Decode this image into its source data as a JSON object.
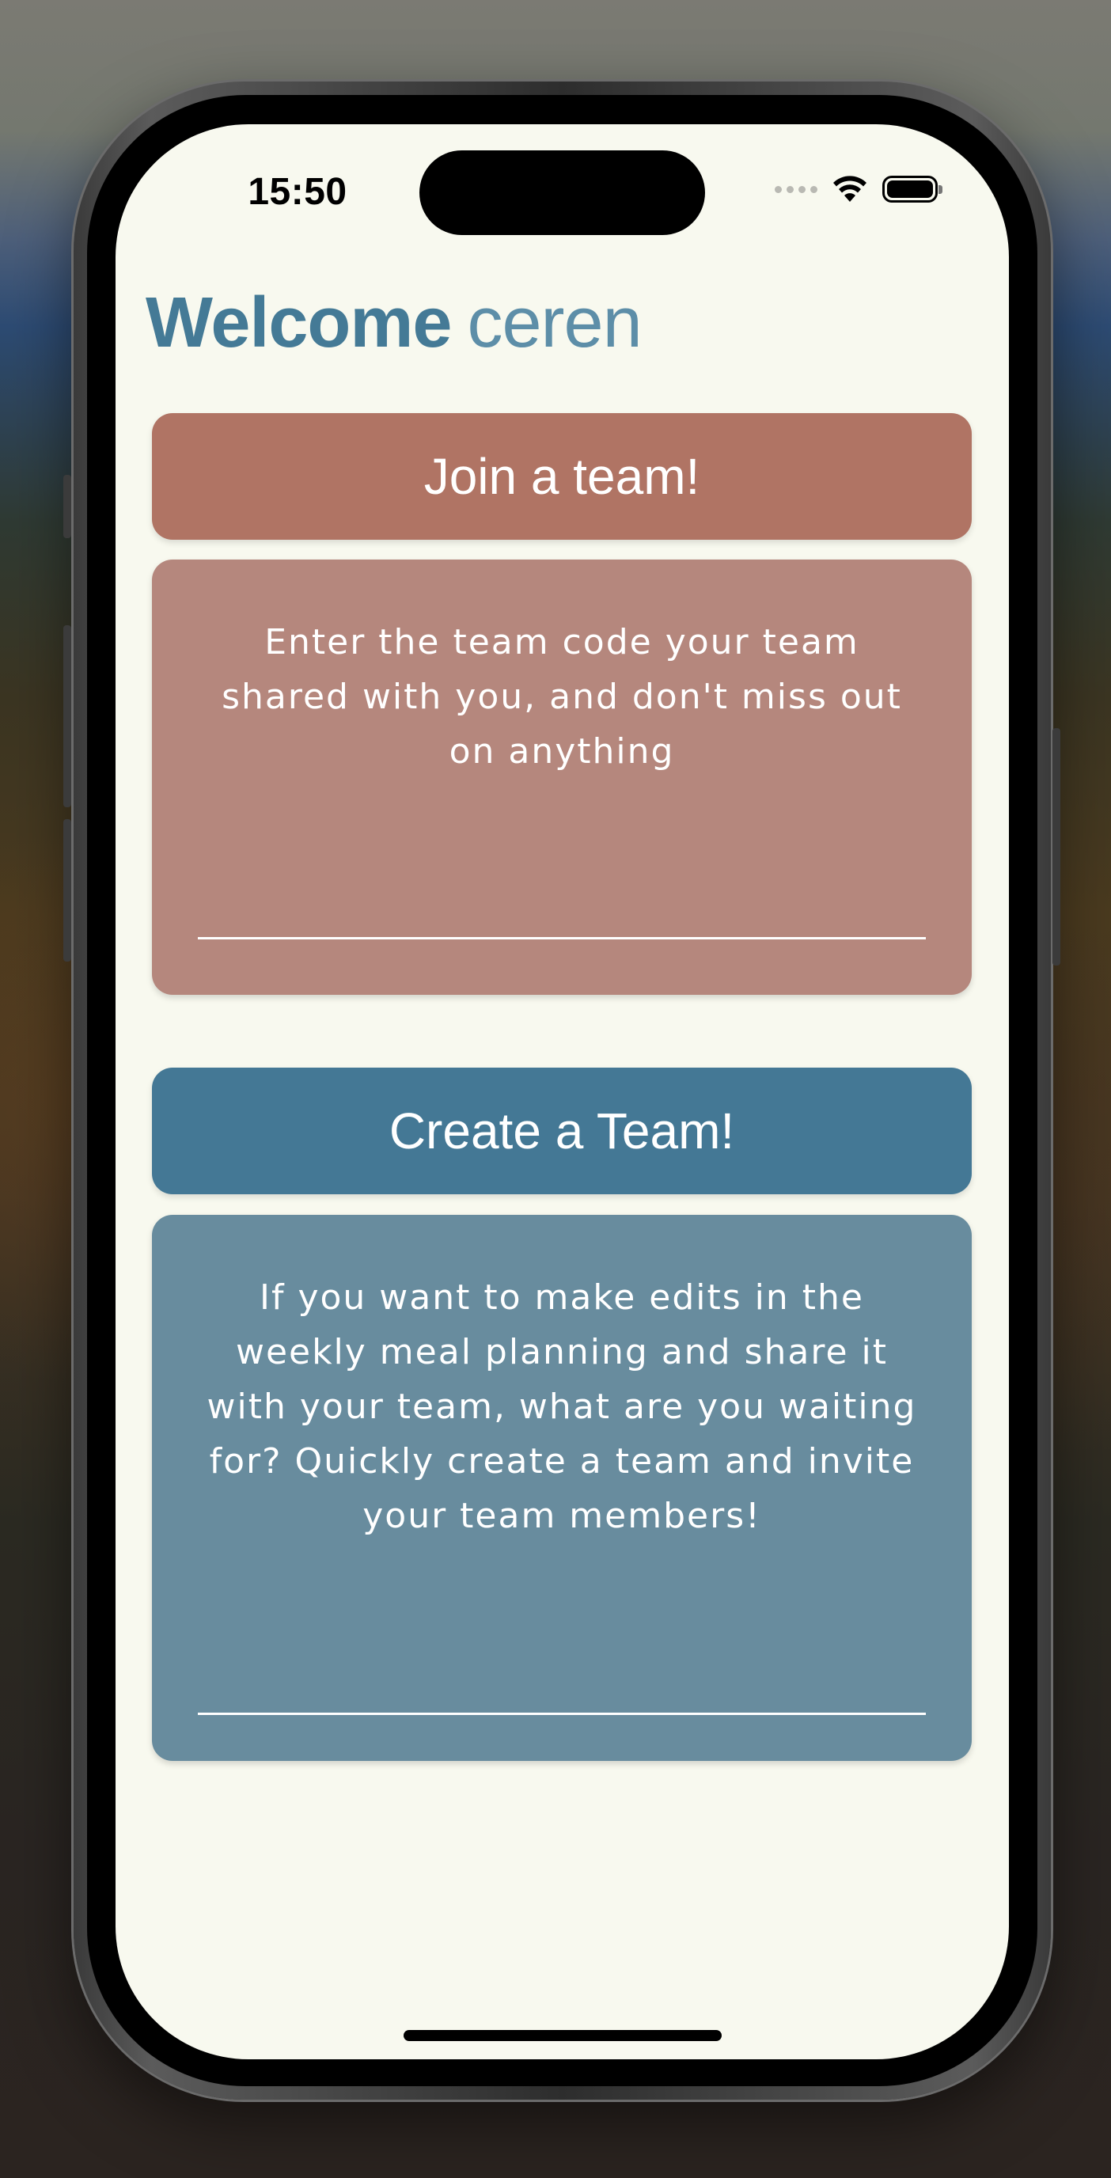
{
  "status_bar": {
    "time": "15:50",
    "icons": [
      "signal-dots-icon",
      "wifi-icon",
      "battery-icon"
    ]
  },
  "header": {
    "welcome": "Welcome",
    "username": "ceren"
  },
  "join_team": {
    "button_label": "Join a team!",
    "description": "Enter the team code your team shared with you, and don't miss out on anything",
    "input_value": ""
  },
  "create_team": {
    "button_label": "Create a Team!",
    "description": "If you want to make edits in the weekly meal planning and share it with your team, what are you waiting for? Quickly create a team and invite your team members!",
    "input_value": ""
  },
  "colors": {
    "background": "#f8f9ef",
    "brand_blue": "#447a96",
    "join_header": "#b07464",
    "join_body": "#b5877d",
    "create_header": "#447895",
    "create_body": "#688c9e"
  }
}
